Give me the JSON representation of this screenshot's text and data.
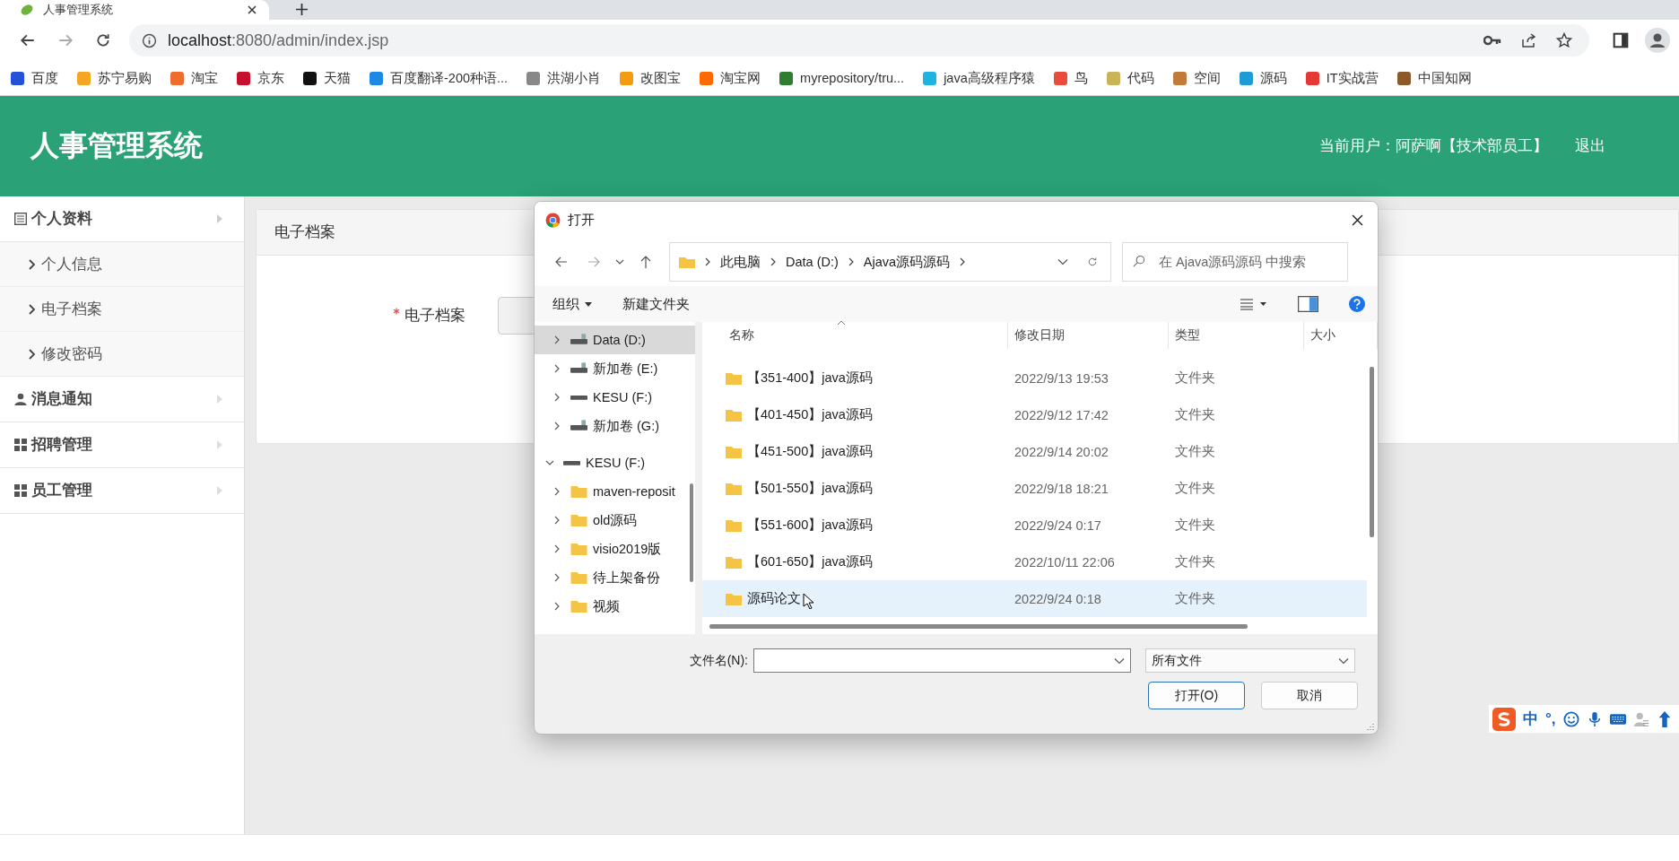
{
  "browser": {
    "tab_title": "人事管理系统",
    "url_host": "localhost",
    "url_rest": ":8080/admin/index.jsp",
    "bookmarks": [
      {
        "label": "百度"
      },
      {
        "label": "苏宁易购"
      },
      {
        "label": "淘宝"
      },
      {
        "label": "京东"
      },
      {
        "label": "天猫"
      },
      {
        "label": "百度翻译-200种语..."
      },
      {
        "label": "洪湖小肖"
      },
      {
        "label": "改图宝"
      },
      {
        "label": "淘宝网"
      },
      {
        "label": "myrepository/tru..."
      },
      {
        "label": "java高级程序猿"
      },
      {
        "label": "鸟"
      },
      {
        "label": "代码"
      },
      {
        "label": "空间"
      },
      {
        "label": "源码"
      },
      {
        "label": "IT实战营"
      },
      {
        "label": "中国知网"
      }
    ]
  },
  "header": {
    "title": "人事管理系统",
    "user": "当前用户：阿萨啊【技术部员工】",
    "logout": "退出"
  },
  "sidebar": [
    {
      "label": "个人资料",
      "kind": "list",
      "expanded": true,
      "children": [
        {
          "label": "个人信息"
        },
        {
          "label": "电子档案"
        },
        {
          "label": "修改密码"
        }
      ]
    },
    {
      "label": "消息通知",
      "kind": "user",
      "expanded": false
    },
    {
      "label": "招聘管理",
      "kind": "grid",
      "expanded": false
    },
    {
      "label": "员工管理",
      "kind": "grid",
      "expanded": false
    }
  ],
  "panel": {
    "title": "电子档案",
    "field_label": "电子档案",
    "required": true
  },
  "dialog": {
    "title": "打开",
    "breadcrumb": [
      "此电脑",
      "Data (D:)",
      "Ajava源码源码"
    ],
    "search_placeholder": "在 Ajava源码源码 中搜索",
    "toolbar": [
      {
        "label": "组织",
        "dropdown": true
      },
      {
        "label": "新建文件夹",
        "dropdown": false
      }
    ],
    "tree": [
      {
        "label": "Data (D:)",
        "kind": "drive",
        "selected": true,
        "expanded": false
      },
      {
        "label": "新加卷 (E:)",
        "kind": "drive",
        "selected": false,
        "expanded": false
      },
      {
        "label": "KESU  (F:)",
        "kind": "usb",
        "selected": false,
        "expanded": false
      },
      {
        "label": "新加卷 (G:)",
        "kind": "drive",
        "selected": false,
        "expanded": false
      },
      {
        "label": "KESU  (F:)",
        "kind": "usb",
        "selected": false,
        "expanded": true,
        "gap": true,
        "children": [
          {
            "label": "maven-reposit",
            "kind": "folder",
            "selected": false,
            "expanded": false
          },
          {
            "label": "old源码",
            "kind": "folder",
            "selected": false,
            "expanded": false
          },
          {
            "label": "visio2019版",
            "kind": "folder",
            "selected": false,
            "expanded": false
          },
          {
            "label": "待上架备份",
            "kind": "folder",
            "selected": false,
            "expanded": false
          },
          {
            "label": "视频",
            "kind": "folder",
            "selected": false,
            "expanded": false
          }
        ]
      }
    ],
    "columns": [
      "名称",
      "修改日期",
      "类型",
      "大小"
    ],
    "files": [
      {
        "name": "【351-400】java源码",
        "date": "2022/9/13 19:53",
        "type": "文件夹",
        "selected": false
      },
      {
        "name": "【401-450】java源码",
        "date": "2022/9/12 17:42",
        "type": "文件夹",
        "selected": false
      },
      {
        "name": "【451-500】java源码",
        "date": "2022/9/14 20:02",
        "type": "文件夹",
        "selected": false
      },
      {
        "name": "【501-550】java源码",
        "date": "2022/9/18 18:21",
        "type": "文件夹",
        "selected": false
      },
      {
        "name": "【551-600】java源码",
        "date": "2022/9/24 0:17",
        "type": "文件夹",
        "selected": false
      },
      {
        "name": "【601-650】java源码",
        "date": "2022/10/11 22:06",
        "type": "文件夹",
        "selected": false
      },
      {
        "name": "源码论文",
        "date": "2022/9/24 0:18",
        "type": "文件夹",
        "selected": true
      }
    ],
    "filename_label": "文件名(N):",
    "filetype": "所有文件",
    "open_button": "打开(O)",
    "cancel_button": "取消"
  },
  "ime": {
    "mode": "中",
    "punct": "°,"
  }
}
